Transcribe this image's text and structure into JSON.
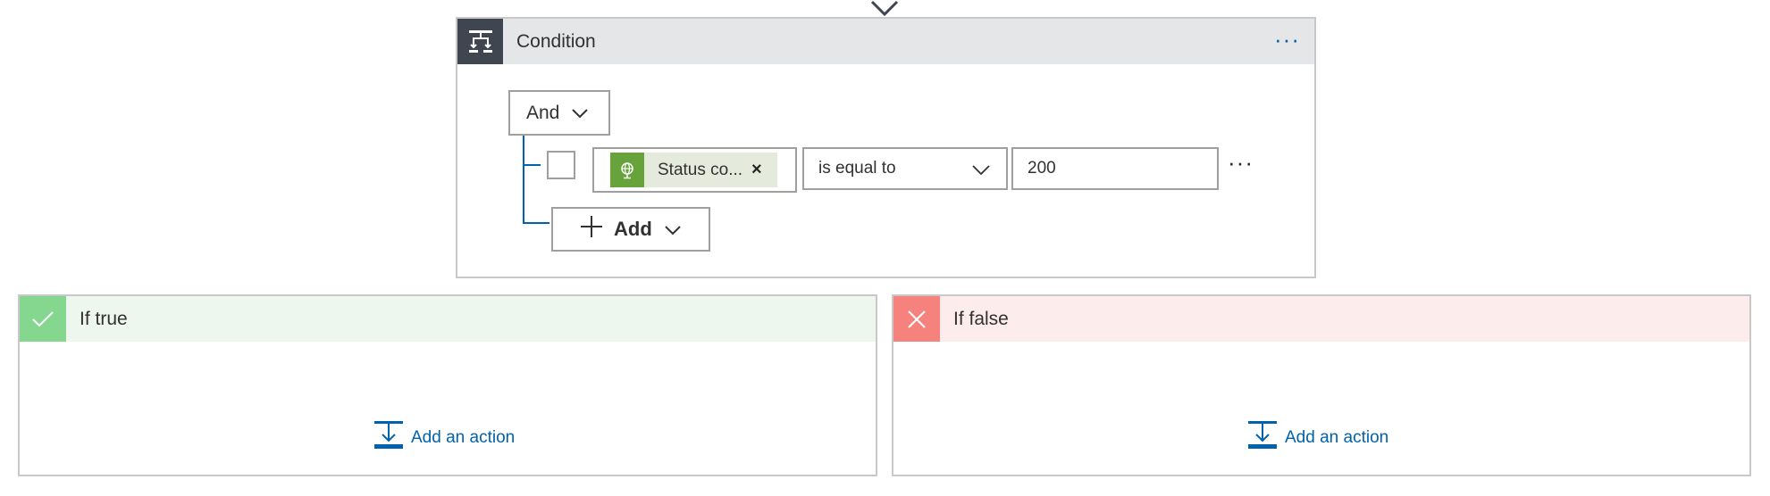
{
  "condition": {
    "title": "Condition",
    "more_label": "···",
    "group_operator": "And",
    "row": {
      "token_label": "Status co...",
      "token_remove": "×",
      "token_icon": "globe-icon",
      "operator": "is equal to",
      "value": "200",
      "more_label": "···"
    },
    "add_label": "Add"
  },
  "branches": {
    "if_true": {
      "title": "If true",
      "add_action_label": "Add an action"
    },
    "if_false": {
      "title": "If false",
      "add_action_label": "Add an action"
    }
  },
  "colors": {
    "accent_blue": "#0062ad",
    "condition_header_bg": "#e5e6e8",
    "condition_icon_bg": "#3f4650",
    "token_icon_bg": "#66a33a",
    "token_bg": "#e5ebdc",
    "true_header_bg": "#edf7ee",
    "true_icon_bg": "#85d68f",
    "false_header_bg": "#fdecec",
    "false_icon_bg": "#f5827c"
  }
}
